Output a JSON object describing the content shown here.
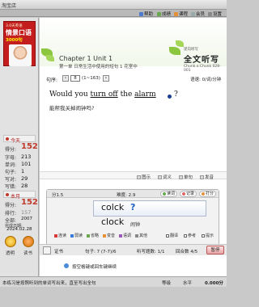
{
  "window": {
    "title": "淘宝店"
  },
  "menu": [
    {
      "label": "帮助",
      "icon": "help-icon",
      "color": "#4c7bd1"
    },
    {
      "label": "成绩",
      "icon": "score-icon",
      "color": "#6aa84f"
    },
    {
      "label": "课程",
      "icon": "course-icon",
      "color": "#e69138"
    },
    {
      "label": "会员",
      "icon": "member-icon",
      "color": "#9aa"
    },
    {
      "label": "设置",
      "icon": "settings-icon",
      "color": "#888"
    }
  ],
  "cover": {
    "line1": "3.0天英语",
    "line2": "情景口语",
    "line3": "3000句"
  },
  "today": {
    "title": "今天",
    "score_label": "得分:",
    "score": "152",
    "rows": [
      {
        "label": "字母:",
        "value": "213"
      },
      {
        "label": "单词:",
        "value": "101"
      },
      {
        "label": "句子:",
        "value": "1"
      },
      {
        "label": "写对:",
        "value": "29"
      },
      {
        "label": "写错:",
        "value": "28"
      }
    ]
  },
  "month": {
    "title": "本月",
    "score_label": "得分:",
    "score": "152",
    "rows": [
      {
        "label": "排行:",
        "value": "157"
      },
      {
        "label": "全部:",
        "value": "2007"
      },
      {
        "label": "完成日期:",
        "value": "2024.02.28"
      }
    ]
  },
  "left_buttons": [
    {
      "label": "透明",
      "icon": "transparent-icon"
    },
    {
      "label": "读书",
      "icon": "read-icon"
    }
  ],
  "lesson": {
    "chapter": "Chapter 1  Unit 1",
    "sub": "第一单  日常生活中使用的短句 1  花室中",
    "brand_small": "逆向听写",
    "brand": "全文听写",
    "brand_sub": "Chunk.o.Chunk 028-001",
    "nav_label": "句序:",
    "nav_value": "8",
    "nav_range": "(1~163)",
    "speed": "语速: 0/词/分钟"
  },
  "sentence": {
    "before": "Would you ",
    "underlined": "turn off",
    "middle": " the ",
    "underlined2": "alarm",
    "after": " ?",
    "translation": "能帮我关掉闹钟吗?"
  },
  "tool_tabs": [
    "图示",
    "词义",
    "单句",
    "发音"
  ],
  "panel": {
    "left": "分1.5",
    "mid": "难度: 2.9",
    "pills": [
      "读词",
      "记录",
      "打分"
    ]
  },
  "answer": {
    "typed": "colck",
    "correct": "clock",
    "meaning": "闹钟"
  },
  "legend": [
    {
      "label": "连读",
      "color": "#d83a3a"
    },
    {
      "label": "弱读",
      "color": "#3a7ad8"
    },
    {
      "label": "省略",
      "color": "#6aa84f"
    },
    {
      "label": "变音",
      "color": "#e69138"
    },
    {
      "label": "语调",
      "color": "#9b59b6"
    },
    {
      "label": "其他",
      "color": "#888888"
    }
  ],
  "legend_right": [
    "翻译",
    "参考",
    "提示"
  ],
  "bottom": {
    "cert": "证书",
    "sent_label": "句子: 7 (7-7)/6",
    "listen_label": "听写题数: 1/1",
    "round_label": "回合数 4/5",
    "pause": "暂停"
  },
  "tip": "按空格键或回车键继续",
  "status": {
    "message": "本练习是按照听到的单词写出来，直至写出全句",
    "r1": "等级",
    "r2": "水平",
    "r3": "0.000分"
  }
}
